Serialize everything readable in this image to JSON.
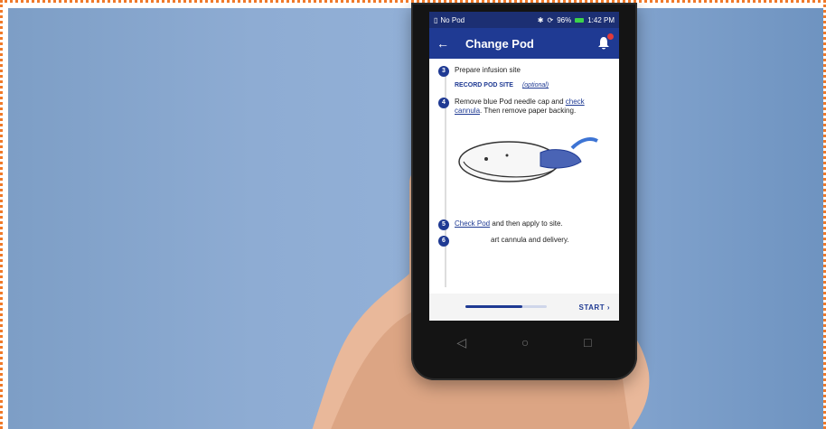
{
  "status_bar": {
    "left": "No Pod",
    "battery": "96%",
    "time": "1:42 PM"
  },
  "appbar": {
    "title": "Change Pod"
  },
  "steps": [
    {
      "num": "3",
      "text": "Prepare infusion site"
    },
    {
      "num": "4",
      "text_before": "Remove blue Pod needle cap and ",
      "link": "check cannula",
      "text_after": ". Then remove paper backing."
    },
    {
      "num": "5",
      "link": "Check Pod",
      "text_after": " and then apply to site."
    },
    {
      "num": "6",
      "text_after": "art cannula and delivery."
    }
  ],
  "record_site": {
    "label": "RECORD POD SITE",
    "optional": "(optional)"
  },
  "bottom": {
    "start_label": "START",
    "progress": 0.7
  },
  "icons": {
    "back": "back-arrow-icon",
    "bell": "notification-bell-icon",
    "chevron": "chevron-right-icon"
  }
}
